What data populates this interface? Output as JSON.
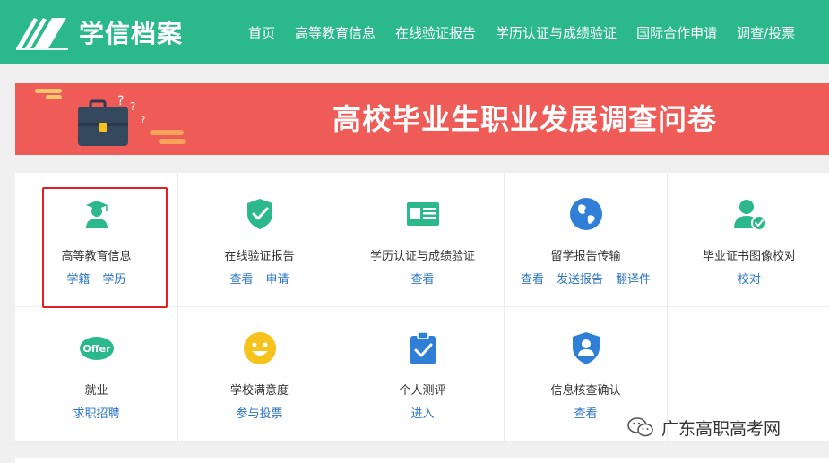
{
  "header": {
    "site_name": "学信档案",
    "nav": [
      "首页",
      "高等教育信息",
      "在线验证报告",
      "学历认证与成绩验证",
      "国际合作申请",
      "调查/投票"
    ]
  },
  "banner": {
    "title": "高校毕业生职业发展调查问卷"
  },
  "services": [
    {
      "label": "高等教育信息",
      "links": [
        "学籍",
        "学历"
      ],
      "icon": "graduate-icon"
    },
    {
      "label": "在线验证报告",
      "links": [
        "查看",
        "申请"
      ],
      "icon": "shield-check-icon"
    },
    {
      "label": "学历认证与成绩验证",
      "links": [
        "查看"
      ],
      "icon": "id-card-icon"
    },
    {
      "label": "留学报告传输",
      "links": [
        "查看",
        "发送报告",
        "翻译件"
      ],
      "icon": "globe-icon"
    },
    {
      "label": "毕业证书图像校对",
      "links": [
        "校对"
      ],
      "icon": "user-check-icon"
    },
    {
      "label": "就业",
      "links": [
        "求职招聘"
      ],
      "icon": "offer-icon",
      "badge": "Offer"
    },
    {
      "label": "学校满意度",
      "links": [
        "参与投票"
      ],
      "icon": "smiley-icon"
    },
    {
      "label": "个人测评",
      "links": [
        "进入"
      ],
      "icon": "clipboard-check-icon"
    },
    {
      "label": "信息核查确认",
      "links": [
        "查看"
      ],
      "icon": "shield-user-icon"
    }
  ],
  "watermark": {
    "text": "广东高职高考网",
    "icon": "wechat-icon"
  },
  "colors": {
    "header": "#2bb88a",
    "banner": "#ef5b57",
    "icon_green": "#2bb88a",
    "icon_blue": "#2f7fd6",
    "icon_yellow": "#f6c21c",
    "link": "#2a74c4",
    "highlight": "#e02020"
  }
}
